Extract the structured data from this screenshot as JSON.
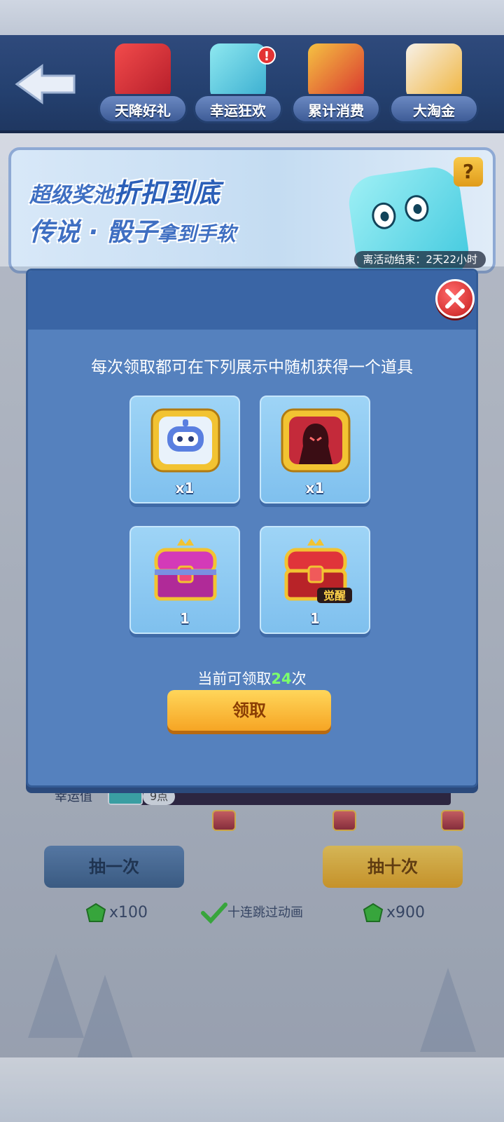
{
  "header": {
    "tabs": [
      {
        "label": "天降好礼",
        "badge": ""
      },
      {
        "label": "幸运狂欢",
        "badge": "!"
      },
      {
        "label": "累计消费",
        "badge": ""
      },
      {
        "label": "大淘金",
        "badge": ""
      }
    ]
  },
  "banner": {
    "line1_a": "超级奖池",
    "line1_b": "折扣到底",
    "line2_a": "传说 · 骰子",
    "line2_b": "拿到手软",
    "help": "?",
    "timer": "离活动结束：2天22小时"
  },
  "modal": {
    "description": "每次领取都可在下列展示中随机获得一个道具",
    "items": [
      {
        "icon": "robot-avatar-icon",
        "qty": "x1"
      },
      {
        "icon": "dark-hero-avatar-icon",
        "qty": "x1"
      },
      {
        "icon": "purple-treasure-chest-icon",
        "qty": "1"
      },
      {
        "icon": "red-awakening-chest-icon",
        "qty": "1",
        "tag": "觉醒"
      }
    ],
    "remain_prefix": "当前可领取",
    "remain_count": "24",
    "remain_suffix": "次",
    "claim_label": "领取"
  },
  "bottom": {
    "luck_label": "幸运值",
    "luck_value": "9点",
    "draw_one_label": "抽一次",
    "draw_ten_label": "抽十次",
    "cost_one": "x100",
    "cost_ten": "x900",
    "skip_label": "十连跳过动画"
  },
  "colors": {
    "modal_bg": "#5581be",
    "claim_button": "#f6a524",
    "count_highlight": "#7cff6a",
    "close_button": "#d62626"
  }
}
